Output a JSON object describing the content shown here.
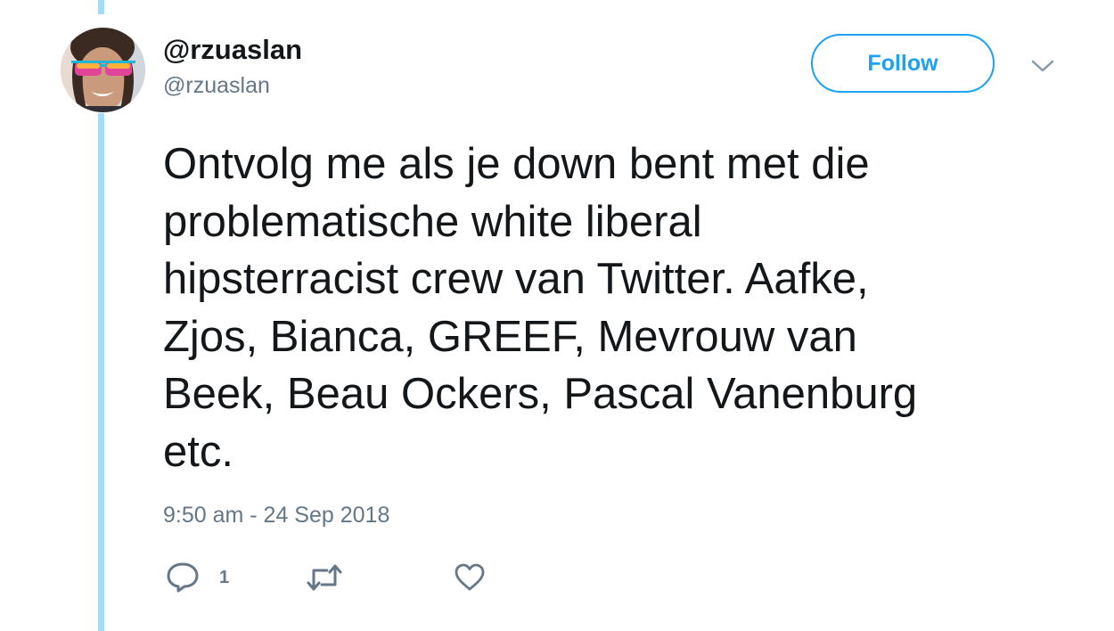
{
  "user": {
    "display_name": "@rzuaslan",
    "handle": "@rzuaslan"
  },
  "follow_button": {
    "label": "Follow"
  },
  "tweet": {
    "text": "Ontvolg me als je down bent met die\nproblematische white liberal\nhipsterracist crew van Twitter. Aafke,\nZjos, Bianca, GREEF, Mevrouw van\nBeek, Beau Ockers, Pascal Vanenburg\netc.",
    "timestamp": "9:50 am - 24 Sep 2018"
  },
  "actions": {
    "reply_count": "1",
    "reply_icon": "reply-icon",
    "retweet_icon": "retweet-icon",
    "like_icon": "heart-icon"
  },
  "colors": {
    "accent": "#1da1f2",
    "thread_line": "#a9daf5",
    "secondary_text": "#657786",
    "primary_text": "#14171a"
  }
}
